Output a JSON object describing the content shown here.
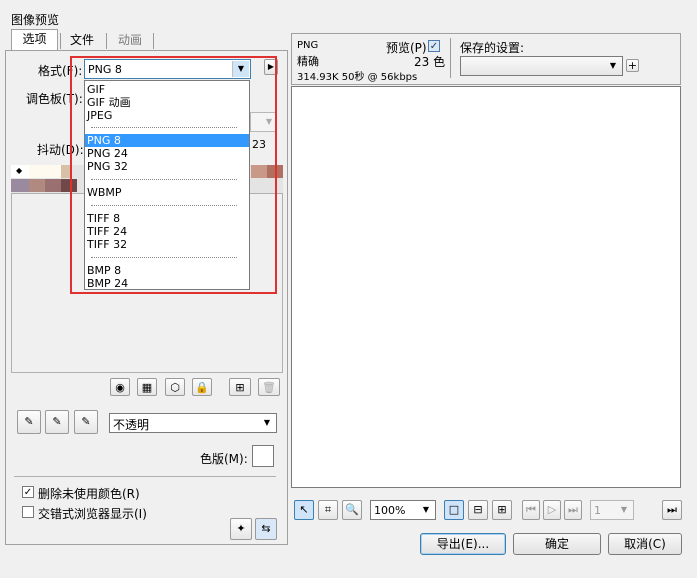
{
  "window": {
    "title": "图像预览"
  },
  "tabs": [
    {
      "label": "选项",
      "active": true
    },
    {
      "label": "文件",
      "active": false
    },
    {
      "label": "动画",
      "active": false,
      "disabled": true
    }
  ],
  "options": {
    "format_label": "格式(F):",
    "format_value": "PNG 8",
    "palette_label": "调色板(T):",
    "dither_label": "抖动(D):",
    "dither_value_partial": "23"
  },
  "format_dropdown": {
    "items": [
      "GIF",
      "GIF 动画",
      "JPEG",
      "PNG 8",
      "PNG 24",
      "PNG 32",
      "WBMP",
      "TIFF 8",
      "TIFF 24",
      "TIFF 32",
      "BMP 8",
      "BMP 24"
    ],
    "selected": "PNG 8"
  },
  "transparency": {
    "value": "不透明"
  },
  "matte": {
    "label": "色版(M):"
  },
  "checkboxes": [
    {
      "label": "删除未使用颜色(R)",
      "checked": true
    },
    {
      "label": "交错式浏览器显示(I)",
      "checked": false
    }
  ],
  "info": {
    "format": "PNG",
    "quality": "精确",
    "size_line": "314.93K  50秒 @ 56kbps",
    "preview_label": "预览(P)",
    "preview_checked": true,
    "colors": "23 色"
  },
  "saved_settings": {
    "label": "保存的设置:",
    "value": ""
  },
  "zoom": {
    "value": "100%"
  },
  "frame": {
    "value": "1"
  },
  "buttons": {
    "export": "导出(E)...",
    "ok": "确定",
    "cancel": "取消(C)"
  },
  "colors": {
    "accent": "#3399ff",
    "annotation": "#e03030",
    "palette": [
      "#ffffff",
      "#f5ead2",
      "#c8a8a8",
      "#a07878",
      "#8a6a6a",
      "#704848",
      "#c89888",
      "#b07060",
      "#9a8aa0",
      "#d8c0a8"
    ]
  }
}
